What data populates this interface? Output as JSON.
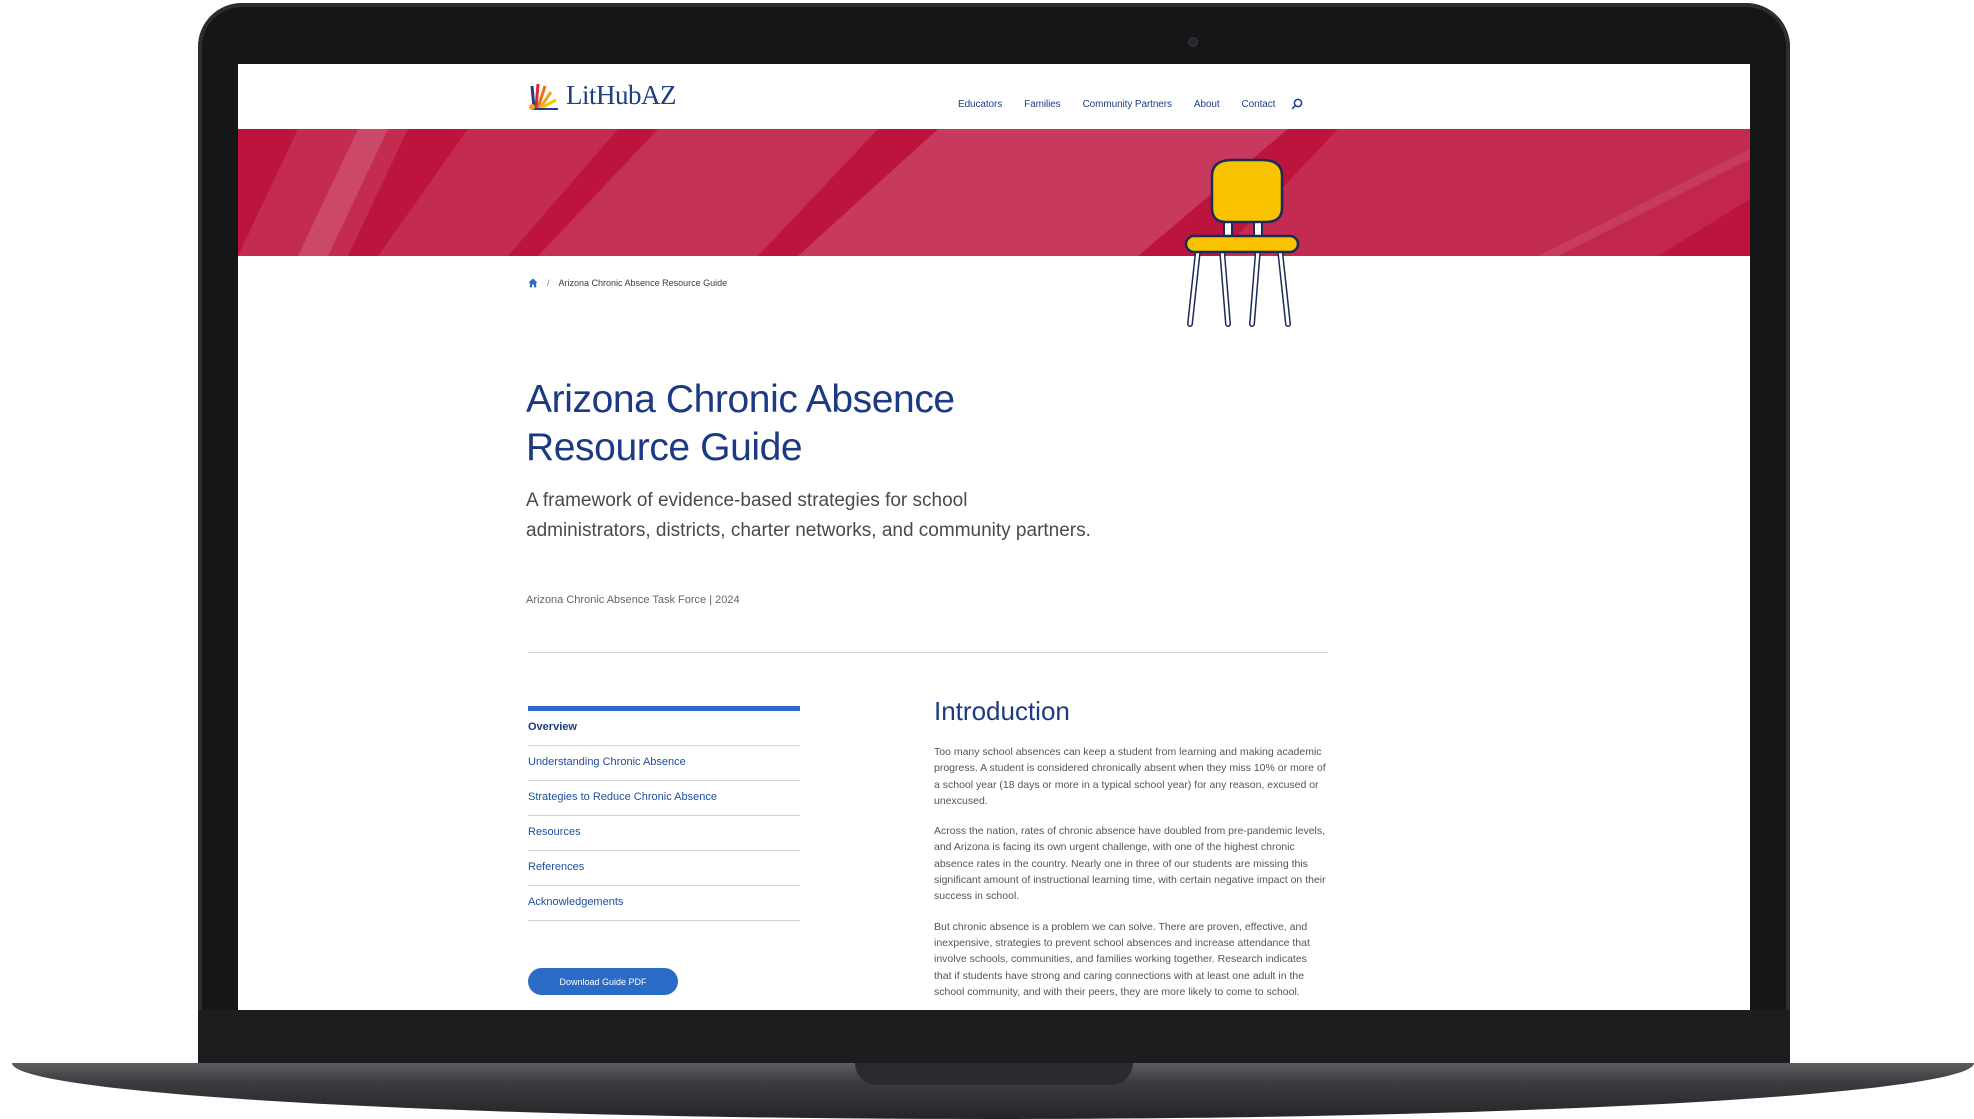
{
  "site": {
    "logo_text": "LitHubAZ",
    "nav": [
      "Educators",
      "Families",
      "Community Partners",
      "About",
      "Contact"
    ]
  },
  "breadcrumb": {
    "current": "Arizona Chronic Absence Resource Guide"
  },
  "page": {
    "title": "Arizona Chronic Absence Resource Guide",
    "subtitle": "A framework of evidence-based strategies for school administrators, districts, charter networks, and community partners.",
    "meta": "Arizona Chronic Absence Task Force | 2024"
  },
  "toc": {
    "items": [
      "Overview",
      "Understanding Chronic Absence",
      "Strategies to Reduce Chronic Absence",
      "Resources",
      "References",
      "Acknowledgements"
    ],
    "active_index": 0,
    "download_label": "Download Guide PDF"
  },
  "intro": {
    "heading": "Introduction",
    "paragraphs": [
      "Too many school absences can keep a student from learning and making academic progress. A student is considered chronically absent when they miss 10% or more of a school year (18 days or more in a typical school year) for any reason, excused or unexcused.",
      "Across the nation, rates of chronic absence have doubled from pre-pandemic levels, and Arizona is facing its own urgent challenge, with one of the highest chronic absence rates in the country. Nearly one in three of our students are missing this significant amount of instructional learning time, with certain negative impact on their success in school.",
      "But chronic absence is a problem we can solve. There are proven, effective, and inexpensive, strategies to prevent school absences and increase attendance that involve schools, communities, and families working together. Research indicates that if students have strong and caring connections with at least one adult in the school community, and with their peers, they are more likely to come to school."
    ]
  },
  "icons": {
    "logo": "sunburst-book-logo",
    "search": "search-icon",
    "home": "home-icon",
    "hero": "chair-illustration"
  },
  "colors": {
    "brand_navy": "#1b3a82",
    "hero_red": "#bd143e",
    "accent_blue": "#2a6cc5",
    "chair_yellow": "#f9c300"
  }
}
